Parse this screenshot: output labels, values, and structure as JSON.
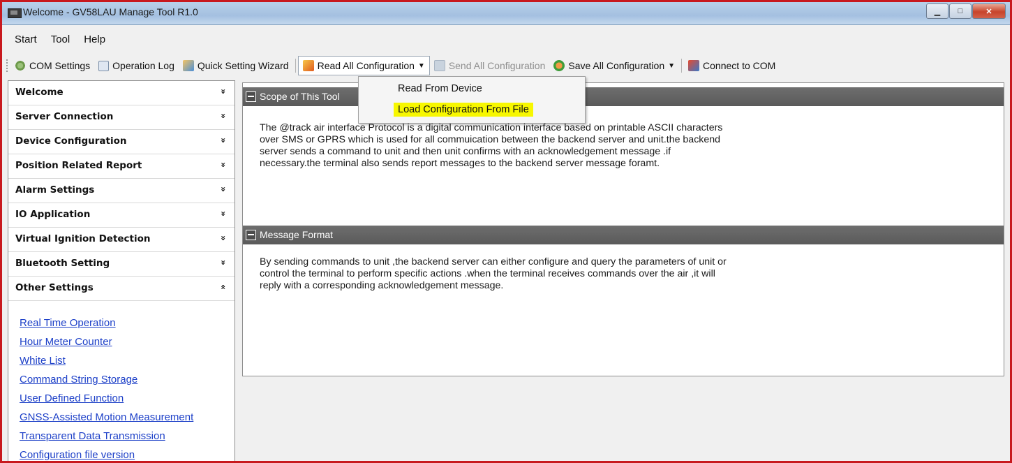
{
  "window": {
    "title": "Welcome - GV58LAU Manage Tool R1.0"
  },
  "menubar": {
    "items": [
      "Start",
      "Tool",
      "Help"
    ]
  },
  "toolbar": {
    "com_settings": "COM Settings",
    "operation_log": "Operation Log",
    "quick_setting_wizard": "Quick Setting Wizard",
    "read_all_configuration": "Read All Configuration",
    "send_all_configuration": "Send All Configuration",
    "save_all_configuration": "Save All Configuration",
    "connect_to_com": "Connect to COM"
  },
  "dropdown": {
    "items": [
      "Read From Device",
      "Load Configuration From File"
    ],
    "highlighted_color": "#f7f700"
  },
  "sidebar": {
    "sections": [
      {
        "label": "Welcome",
        "chevron": "»"
      },
      {
        "label": "Server Connection",
        "chevron": "»"
      },
      {
        "label": "Device Configuration",
        "chevron": "»"
      },
      {
        "label": "Position Related Report",
        "chevron": "»"
      },
      {
        "label": "Alarm Settings",
        "chevron": "»"
      },
      {
        "label": "IO Application",
        "chevron": "»"
      },
      {
        "label": "Virtual Ignition Detection",
        "chevron": "»"
      },
      {
        "label": "Bluetooth Setting",
        "chevron": "»"
      },
      {
        "label": "Other Settings",
        "chevron": "«"
      }
    ],
    "links": [
      "Real Time Operation",
      "Hour Meter Counter",
      "White List",
      "Command String Storage",
      "User Defined Function",
      "GNSS-Assisted Motion Measurement",
      "Transparent Data Transmission",
      "Configuration file version"
    ]
  },
  "content": {
    "sections": [
      {
        "title": "Scope of This Tool",
        "lines": [
          "The @track air interface Protocol is a digital communication interface based on printable ASCII characters",
          "over SMS or GPRS which is used for all commuication between the backend server and unit.the backend",
          "server sends a command to unit and then unit confirms with an acknowledgement message .if",
          "necessary.the terminal also sends report messages to the backend server message foramt."
        ]
      },
      {
        "title": "Message Format",
        "lines": [
          "By sending commands to unit ,the backend server can either configure and query the parameters of unit or",
          "control the terminal to perform specific actions .when the terminal receives commands over the air ,it will",
          "reply with a corresponding acknowledgement message."
        ]
      }
    ]
  },
  "colors": {
    "window_border": "#c8191e",
    "section_header": "#656565",
    "link": "#1d40c8"
  }
}
